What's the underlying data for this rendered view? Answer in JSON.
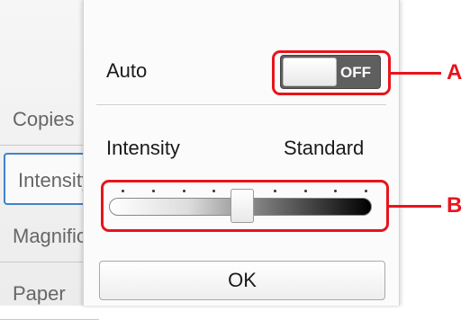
{
  "background_list": {
    "items": [
      {
        "label": "Copies"
      },
      {
        "label": "Intensity"
      },
      {
        "label": "Magnification"
      },
      {
        "label": "Paper"
      }
    ]
  },
  "popup": {
    "auto_label": "Auto",
    "auto_toggle_state": "OFF",
    "intensity_label": "Intensity",
    "intensity_value": "Standard",
    "slider_level_fraction": 0.5,
    "slider_tick_count": 9,
    "ok_label": "OK"
  },
  "callouts": {
    "a_label": "A",
    "b_label": "B"
  },
  "colors": {
    "callout": "#e8141c",
    "selection": "#3f83c8"
  }
}
